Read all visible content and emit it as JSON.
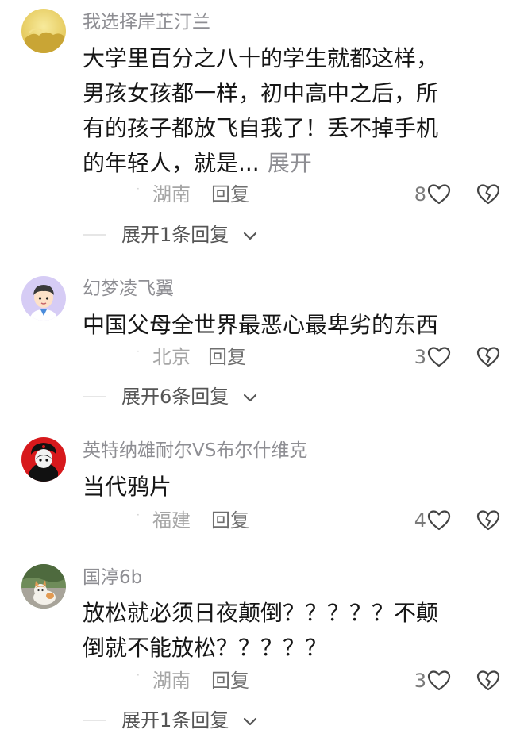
{
  "comments": [
    {
      "username": "我选择岸芷汀兰",
      "text_lines": [
        "大学里百分之八十的学生就都这样，",
        "男孩女孩都一样，初中高中之后，所",
        "有的孩子都放飞自我了！丢不掉手机",
        "的年轻人，就是..."
      ],
      "expand_text": "展开",
      "location": "湖南",
      "reply_label": "回复",
      "likes": "8",
      "replies_expand": "展开1条回复",
      "avatar_icon": "gold-landscape-avatar"
    },
    {
      "username": "幻梦凌飞翼",
      "text_lines": [
        "中国父母全世界最恶心最卑劣的东西"
      ],
      "location": "北京",
      "reply_label": "回复",
      "likes": "3",
      "replies_expand": "展开6条回复",
      "avatar_icon": "cartoon-boy-avatar"
    },
    {
      "username": "英特纳雄耐尔VS布尔什维克",
      "text_lines": [
        "当代鸦片"
      ],
      "location": "福建",
      "reply_label": "回复",
      "likes": "4",
      "avatar_icon": "red-portrait-avatar"
    },
    {
      "username": "国渟6b",
      "text_lines": [
        "放松就必须日夜颠倒？？？？？不颠",
        "倒就不能放松？？？？？"
      ],
      "location": "湖南",
      "reply_label": "回复",
      "likes": "3",
      "replies_expand": "展开1条回复",
      "avatar_icon": "cat-photo-avatar"
    }
  ],
  "icons": {
    "like": "heart-icon",
    "dislike": "broken-heart-icon",
    "expand": "chevron-down-icon"
  }
}
